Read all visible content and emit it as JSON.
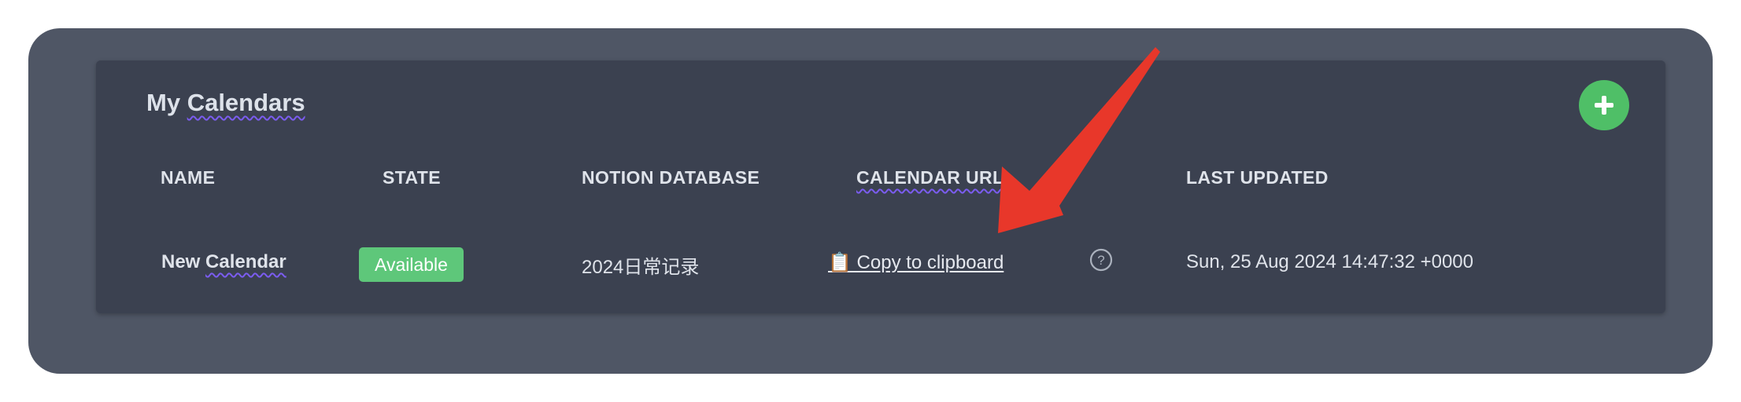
{
  "header": {
    "title_part1": "My ",
    "title_part2": "Calendars",
    "add_label": "+"
  },
  "table": {
    "columns": [
      "NAME",
      "STATE",
      "NOTION DATABASE",
      "CALENDAR URL",
      "LAST UPDATED"
    ],
    "rows": [
      {
        "name_part1": "New ",
        "name_part2": "Calendar",
        "state": "Available",
        "notion_database": "2024日常记录",
        "calendar_url_link": "📋 Copy to clipboard",
        "help": "?",
        "last_updated": "Sun, 25 Aug 2024 14:47:32 +0000"
      }
    ]
  },
  "colors": {
    "outer_bg": "#4f5665",
    "card_bg": "#3b4150",
    "accent_green": "#4fbf67",
    "badge_green": "#5ec77a",
    "annotation_arrow": "#e8372a"
  },
  "icons": {
    "add": "plus-icon",
    "help": "question-circle-icon",
    "clipboard": "clipboard-icon",
    "annotation": "red-arrow-annotation"
  }
}
